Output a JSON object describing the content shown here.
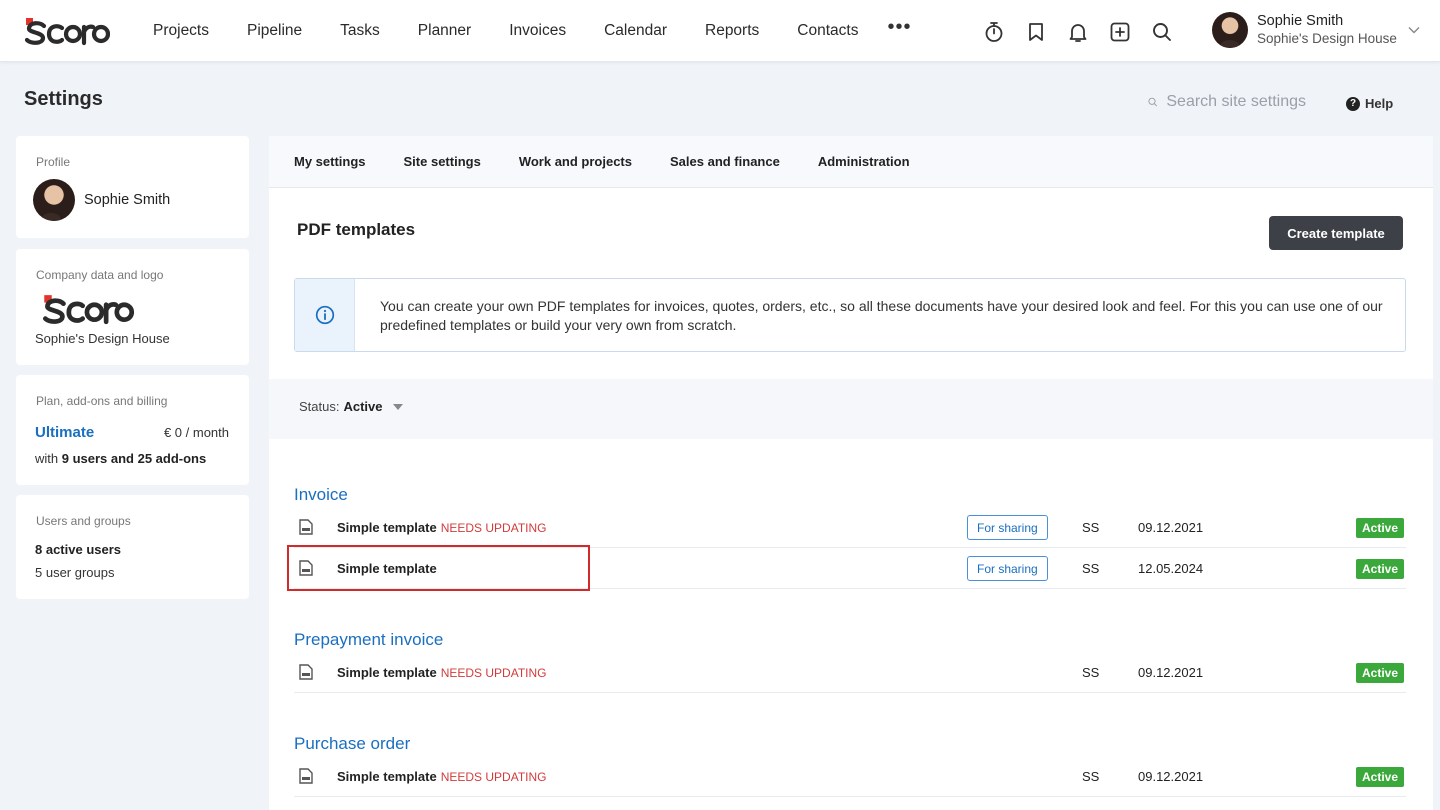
{
  "app": {
    "logo_text": "Scoro"
  },
  "nav": {
    "items": [
      "Projects",
      "Pipeline",
      "Tasks",
      "Planner",
      "Invoices",
      "Calendar",
      "Reports",
      "Contacts"
    ],
    "more": "•••"
  },
  "top_icons": [
    "timer-icon",
    "bookmark-icon",
    "bell-icon",
    "add-icon",
    "search-icon"
  ],
  "user": {
    "name": "Sophie Smith",
    "company": "Sophie's Design House"
  },
  "page": {
    "title": "Settings",
    "search_placeholder": "Search site settings",
    "help": "Help"
  },
  "sidebar": {
    "profile": {
      "label": "Profile",
      "name": "Sophie Smith"
    },
    "company": {
      "label": "Company data and logo",
      "name": "Sophie's Design House"
    },
    "plan": {
      "label": "Plan, add-ons and billing",
      "name": "Ultimate",
      "price": "€ 0 / month",
      "users_prefix": "with ",
      "users_bold": "9 users and 25 add-ons"
    },
    "users": {
      "label": "Users and groups",
      "active": "8 active users",
      "groups": "5 user groups"
    }
  },
  "tabs": [
    "My settings",
    "Site settings",
    "Work and projects",
    "Sales and finance",
    "Administration"
  ],
  "main": {
    "title": "PDF templates",
    "create_button": "Create template",
    "info": "You can create your own PDF templates for invoices, quotes, orders, etc., so all these documents have your desired look and feel. For this you can use one of our predefined templates or build your very own from scratch.",
    "filter_label": "Status: ",
    "filter_value": "Active"
  },
  "groups": [
    {
      "title": "Invoice",
      "rows": [
        {
          "name": "Simple template",
          "needs": "NEEDS UPDATING",
          "share": "For sharing",
          "owner": "SS",
          "date": "09.12.2021",
          "status": "Active"
        },
        {
          "name": "Simple template",
          "needs": "",
          "share": "For sharing",
          "owner": "SS",
          "date": "12.05.2024",
          "status": "Active"
        }
      ]
    },
    {
      "title": "Prepayment invoice",
      "rows": [
        {
          "name": "Simple template",
          "needs": "NEEDS UPDATING",
          "share": "",
          "owner": "SS",
          "date": "09.12.2021",
          "status": "Active"
        }
      ]
    },
    {
      "title": "Purchase order",
      "rows": [
        {
          "name": "Simple template",
          "needs": "NEEDS UPDATING",
          "share": "",
          "owner": "SS",
          "date": "09.12.2021",
          "status": "Active"
        }
      ]
    }
  ],
  "colors": {
    "accent": "#1a6fc1",
    "active": "#3ba83b",
    "warning": "#d23b3b",
    "highlight": "#d12a2a",
    "logo_red": "#e4332a"
  }
}
